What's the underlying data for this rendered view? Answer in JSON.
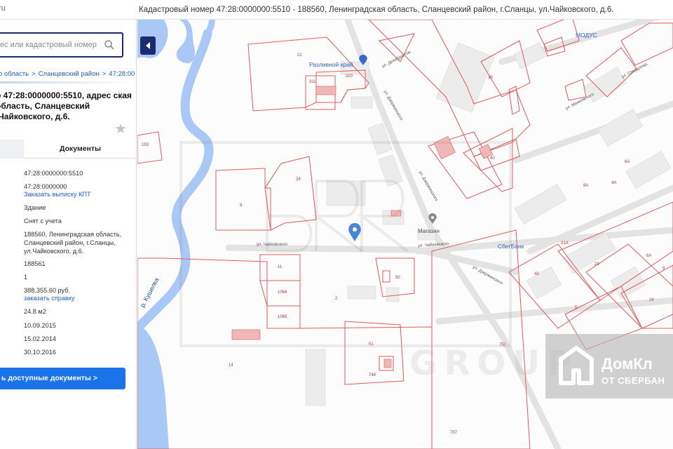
{
  "site_fragment": "ru",
  "page_heading": "Кадастровый номер 47:28:0000000:5510 - 188560, Ленинградская область, Сланцевский район, г.Сланцы, ул.Чайковского, д.6.",
  "search": {
    "placeholder": "ес или кадастровый номер"
  },
  "breadcrumb": [
    "о область",
    "Сланцевский район",
    "47:28:00"
  ],
  "object_title": "р 47:28:0000000:5510, адрес ская область, Сланцевский .Чайковского, д.6.",
  "tabs": {
    "documents": "Документы"
  },
  "fields": {
    "cadastral_number": "47:28:0000000:5510",
    "quarter": "47:28:0000000",
    "order_kpt": "Заказать выписку КПТ",
    "object_type": "Здание",
    "status": "Снят с учета",
    "address": "188560, Ленинградская область, Сланцевский район, г.Сланцы, ул.Чайковского, д.6.",
    "index": "188561",
    "floors": "1",
    "cost": "388,355.60 руб.",
    "order_certificate": "заказать справку",
    "area": "24.8 м2",
    "date_registered": "10.09.2015",
    "date_updated": "15.02.2014",
    "date_removed": "30.10.2016"
  },
  "docs_button": "ь доступные документы >",
  "map": {
    "pois": {
      "razlivnoy": "Разливной край",
      "modus": "МОДУС",
      "magazin": "Магазин",
      "sberbank": "СбегБанк"
    },
    "river": "р. Кушелка",
    "streets": {
      "chaikovskogo_1": "ул. Чайковского",
      "chaikovskogo_2": "ул. Чайковского",
      "dzerzhinskogo_1": "ул. Дзержинского",
      "dzerzhinskogo_2": "ул. Дзержинского",
      "dzerzhinskogo_3": "ул. Дзержинского",
      "dekabristov": "ул. Декабристов",
      "sverdlova": "ул. Свердлова",
      "mayakovskogo": "ул. Маяковского"
    },
    "parcel_numbers": [
      "21",
      "320",
      "311",
      "153",
      "8",
      "24",
      "40",
      "39",
      "6А",
      "4А",
      "8А",
      "11",
      "1064",
      "1065",
      "50",
      "2",
      "51",
      "748",
      "14",
      "757",
      "757",
      "21А",
      "23",
      "49",
      "5",
      "24",
      "9",
      "6А"
    ],
    "watermark": "GROUP"
  },
  "banner": {
    "name": "ДомКл",
    "sub": "ОТ СБЕРБАН"
  },
  "colors": {
    "accent": "#1a73e8",
    "navy": "#1a2b6e",
    "parcel_red": "#e05a5a",
    "water": "#a9c8f5"
  }
}
